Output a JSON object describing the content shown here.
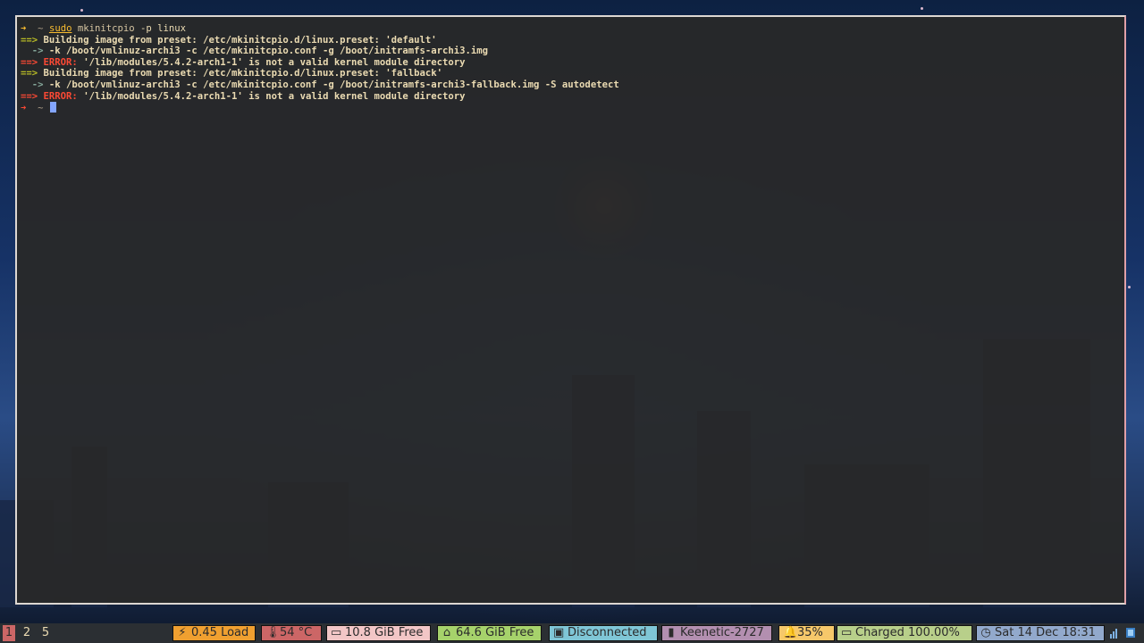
{
  "terminal": {
    "lines": [
      {
        "arrow": "➜",
        "tilde": "~",
        "sudo": "sudo",
        "cmd": "mkinitcpio",
        "args": "-p linux"
      },
      {
        "prefix": "==>",
        "text": "Building image from preset: /etc/mkinitcpio.d/linux.preset: 'default'"
      },
      {
        "prefix": "  ->",
        "text": "-k /boot/vmlinuz-archi3 -c /etc/mkinitcpio.conf -g /boot/initramfs-archi3.img"
      },
      {
        "prefix": "==>",
        "label": "ERROR:",
        "text": "'/lib/modules/5.4.2-arch1-1' is not a valid kernel module directory"
      },
      {
        "prefix": "==>",
        "text": "Building image from preset: /etc/mkinitcpio.d/linux.preset: 'fallback'"
      },
      {
        "prefix": "  ->",
        "text": "-k /boot/vmlinuz-archi3 -c /etc/mkinitcpio.conf -g /boot/initramfs-archi3-fallback.img -S autodetect"
      },
      {
        "prefix": "==>",
        "label": "ERROR:",
        "text": "'/lib/modules/5.4.2-arch1-1' is not a valid kernel module directory"
      },
      {
        "arrow": "➜",
        "tilde": "~"
      }
    ]
  },
  "statusbar": {
    "workspaces": [
      "1",
      "2",
      "5"
    ],
    "active_workspace": "1",
    "modules": [
      {
        "icon": "load-icon",
        "glyph": "⚡",
        "text": "0.45 Load",
        "color": "#f0a030"
      },
      {
        "icon": "thermometer-icon",
        "glyph": "🌡",
        "text": "54 °C",
        "color": "#cc6666"
      },
      {
        "icon": "drive-icon",
        "glyph": "▭",
        "text": "10.8 GiB Free",
        "color": "#f2c6c6"
      },
      {
        "icon": "home-icon",
        "glyph": "⌂",
        "text": "64.6 GiB Free",
        "color": "#a6d26b"
      },
      {
        "icon": "monitor-icon",
        "glyph": "▣",
        "text": "Disconnected",
        "color": "#7fc6d6"
      },
      {
        "icon": "signal-icon",
        "glyph": "▮",
        "text": "Keenetic-2727",
        "color": "#b38fb0"
      },
      {
        "icon": "bell-icon",
        "glyph": "🔔",
        "text": "35%",
        "color": "#f6c86a"
      },
      {
        "icon": "battery-icon",
        "glyph": "▭",
        "text": "Charged 100.00%",
        "color": "#b8cf8a"
      },
      {
        "icon": "clock-icon",
        "glyph": "◷",
        "text": "Sat 14 Dec 18:31",
        "color": "#92a9cc"
      }
    ]
  }
}
